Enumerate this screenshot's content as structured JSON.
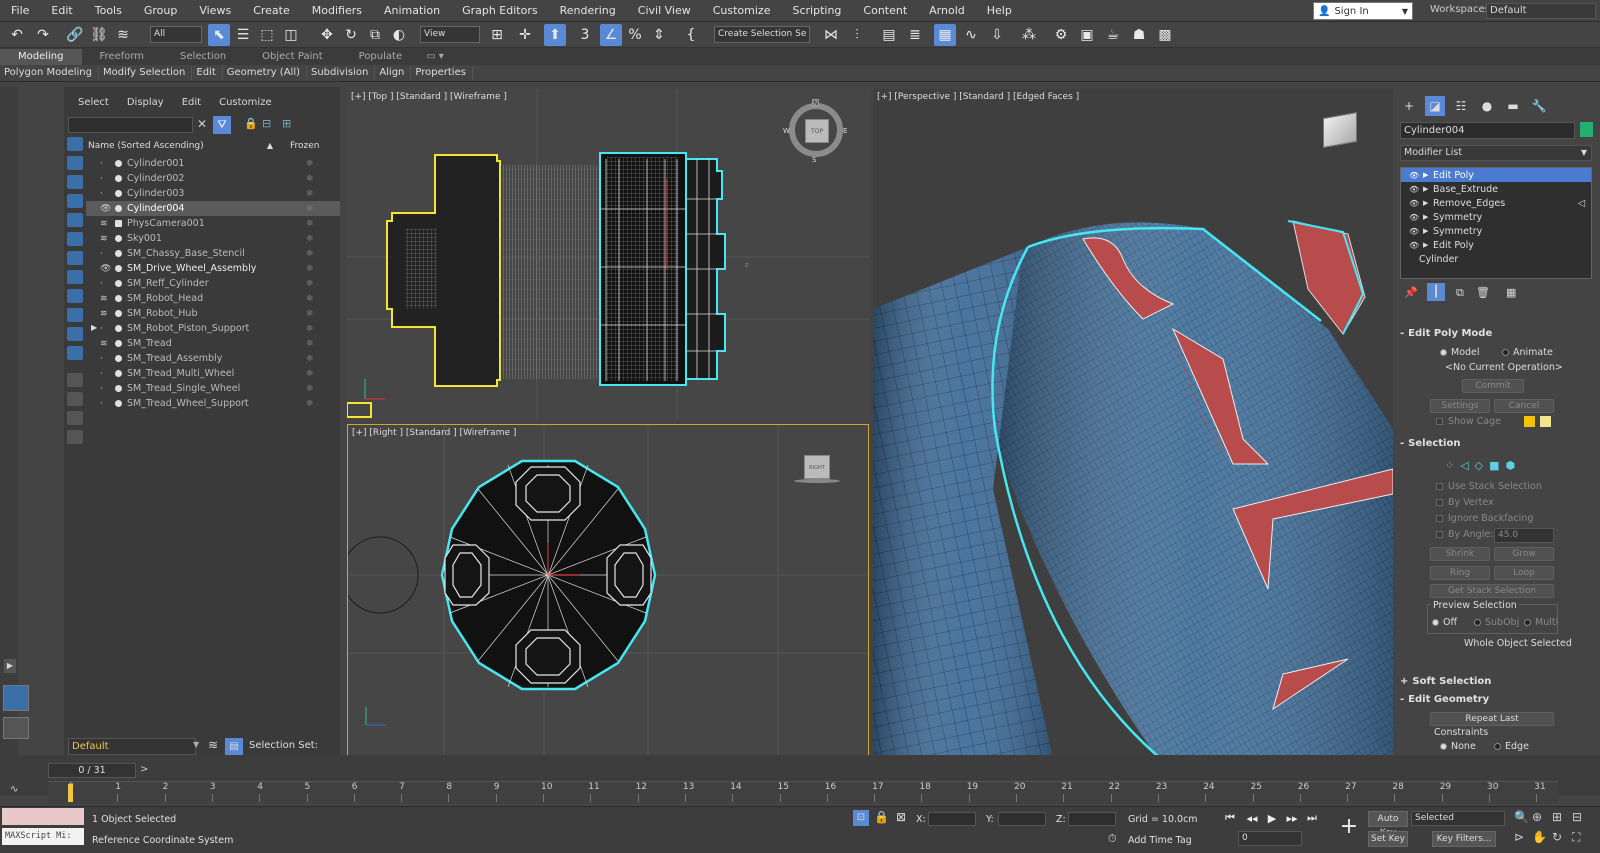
{
  "menus": [
    "File",
    "Edit",
    "Tools",
    "Group",
    "Views",
    "Create",
    "Modifiers",
    "Animation",
    "Graph Editors",
    "Rendering",
    "Civil View",
    "Customize",
    "Scripting",
    "Content",
    "Arnold",
    "Help"
  ],
  "signin": "Sign In",
  "workspace": {
    "label": "Workspaces:",
    "value": "Default"
  },
  "toolbar": {
    "filter": "All",
    "ref_coord": "View",
    "selection_set": "Create Selection Se"
  },
  "ribbon": {
    "tabs": [
      "Modeling",
      "Freeform",
      "Selection",
      "Object Paint",
      "Populate"
    ],
    "items": [
      "Polygon Modeling",
      "Modify Selection",
      "Edit",
      "Geometry (All)",
      "Subdivision",
      "Align",
      "Properties"
    ]
  },
  "explorer": {
    "menu": [
      "Select",
      "Display",
      "Edit",
      "Customize"
    ],
    "col_name": "Name (Sorted Ascending)",
    "col_frozen": "Frozen",
    "rows": [
      "Cylinder001",
      "Cylinder002",
      "Cylinder003",
      "Cylinder004",
      "PhysCamera001",
      "Sky001",
      "SM_Chassy_Base_Stencil",
      "SM_Drive_Wheel_Assembly",
      "SM_Reff_Cylinder",
      "SM_Robot_Head",
      "SM_Robot_Hub",
      "SM_Robot_Piston_Support",
      "SM_Tread",
      "SM_Tread_Assembly",
      "SM_Tread_Multi_Wheel",
      "SM_Tread_Single_Wheel",
      "SM_Tread_Wheel_Support"
    ],
    "selected_row": "Cylinder004",
    "layer": "Default",
    "selection_set_label": "Selection Set:"
  },
  "viewports": {
    "top": "[+] [Top ] [Standard ] [Wireframe ]",
    "right": "[+] [Right ] [Standard ] [Wireframe ]",
    "persp": "[+] [Perspective ] [Standard ] [Edged Faces ]",
    "top_cube": "TOP",
    "right_cube": "RIGHT",
    "compass": {
      "n": "N",
      "s": "S",
      "e": "E",
      "w": "W"
    }
  },
  "command_panel": {
    "object_name": "Cylinder004",
    "modifier_list": "Modifier List",
    "stack": [
      "Edit Poly",
      "Base_Extrude",
      "Remove_Edges",
      "Symmetry",
      "Symmetry",
      "Edit Poly",
      "Cylinder"
    ],
    "edit_poly_mode": {
      "title": "Edit Poly Mode",
      "model": "Model",
      "animate": "Animate",
      "no_op": "<No Current Operation>",
      "commit": "Commit",
      "settings": "Settings",
      "cancel": "Cancel",
      "show_cage": "Show Cage"
    },
    "selection": {
      "title": "Selection",
      "use_stack": "Use Stack Selection",
      "by_vertex": "By Vertex",
      "ignore_backfacing": "Ignore Backfacing",
      "by_angle": "By Angle:",
      "angle": "45.0",
      "shrink": "Shrink",
      "grow": "Grow",
      "ring": "Ring",
      "loop": "Loop",
      "get_stack": "Get Stack Selection",
      "preview": "Preview Selection",
      "off": "Off",
      "subobj": "SubObj",
      "multi": "Multi",
      "whole": "Whole Object Selected"
    },
    "soft_selection": "Soft Selection",
    "edit_geometry": {
      "title": "Edit Geometry",
      "repeat_last": "Repeat Last",
      "constraints": "Constraints",
      "none": "None",
      "edge": "Edge"
    }
  },
  "timeline": {
    "counter": "0 / 31",
    "ticks": [
      "0",
      "1",
      "2",
      "3",
      "4",
      "5",
      "6",
      "7",
      "8",
      "9",
      "10",
      "11",
      "12",
      "13",
      "14",
      "15",
      "16",
      "17",
      "18",
      "19",
      "20",
      "21",
      "22",
      "23",
      "24",
      "25",
      "26",
      "27",
      "28",
      "29",
      "30",
      "31"
    ]
  },
  "status": {
    "script": "MAXScript Mi:",
    "selected": "1 Object Selected",
    "ref_coord": "Reference Coordinate System",
    "x": "X:",
    "y": "Y:",
    "z": "Z:",
    "grid": "Grid = 10.0cm",
    "add_time_tag": "Add Time Tag",
    "auto_key": "Auto Key",
    "set_key": "Set Key",
    "selected_dd": "Selected",
    "key_filters": "Key Filters...",
    "frame": "0"
  },
  "colors": {
    "accent": "#5a8ad6",
    "selection_cyan": "#3fe4f0",
    "selected_wire": "#f0e830",
    "mesh_blue": "#3f6d9a",
    "red_faces": "#b84c4c"
  }
}
